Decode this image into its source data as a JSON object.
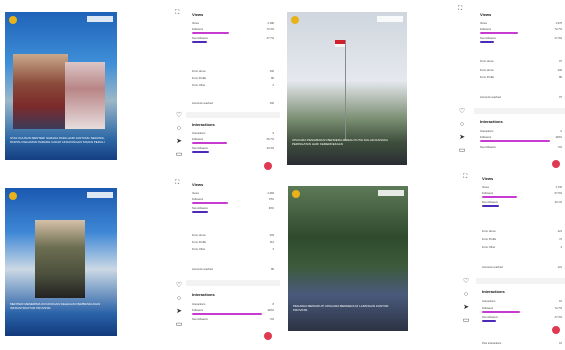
{
  "colors": {
    "followers": "#c63bd0",
    "non_followers": "#4d2bb8",
    "badge": "#e03a52"
  },
  "posts": [
    {
      "brand": "BerAKHLAK",
      "caption": "STAF KHUSUS MENTERI SARANA PADA HARI JANTUNG SEDUNIA, PANTAU KEGIATAN PARADE CAKAP LINGKUNGAN TAMAN PEDULI",
      "style": "blue"
    },
    {
      "brand": "BerAKHLAK",
      "caption": "UPACARA PENGIBARAN BENDERA MERAH PUTIH DALAM RANGKA PERINGATAN HARI KEMERDEKAAN",
      "style": "photo"
    },
    {
      "brand": "BerAKHLAK",
      "caption": "MENTERI MENERIMA KUNJUNGAN DELEGASI PEMBANGUNAN INFRASTRUKTUR PROVINSI",
      "style": "blue"
    },
    {
      "brand": "BerAKHLAK",
      "caption": "PEGAWAI MENGIKUTI UPACARA BENDERA DI LAPANGAN KANTOR PROVINSI",
      "style": "photo"
    }
  ],
  "insights": [
    {
      "views_title": "Views",
      "views_total": "2,180",
      "followers_label": "Followers",
      "followers_pct": "72.3%",
      "followers_frac": 0.72,
      "nonfollowers_label": "Non-followers",
      "nonfollowers_pct": "27.7%",
      "nonfollowers_frac": 0.28,
      "sources": [
        {
          "label": "From Home",
          "value": "192"
        },
        {
          "label": "From Profile",
          "value": "86"
        },
        {
          "label": "From Other",
          "value": "2"
        }
      ],
      "reached_label": "Accounts reached",
      "reached_value": "192",
      "interactions_title": "Interactions",
      "interactions_total": "9",
      "i_followers_pct": "66.7%",
      "i_followers_frac": 0.67,
      "i_nonfollowers_pct": "33.3%",
      "i_nonfollowers_frac": 0.33
    },
    {
      "views_title": "Views",
      "views_total": "1,976",
      "followers_label": "Followers",
      "followers_pct": "72.7%",
      "followers_frac": 0.73,
      "nonfollowers_label": "Non-followers",
      "nonfollowers_pct": "27.3%",
      "nonfollowers_frac": 0.27,
      "sources": [
        {
          "label": "From Home",
          "value": "97"
        },
        {
          "label": "From Home",
          "value": "232"
        },
        {
          "label": "From Profile",
          "value": "86"
        }
      ],
      "reached_label": "Accounts reached",
      "reached_value": "97",
      "interactions_title": "Interactions",
      "interactions_total": "6",
      "i_followers_pct": "100%",
      "i_followers_frac": 1.0,
      "i_nonfollowers_pct": "0%",
      "i_nonfollowers_frac": 0.0
    },
    {
      "views_title": "Views",
      "views_total": "2,284",
      "followers_label": "Followers",
      "followers_pct": "70%",
      "followers_frac": 0.7,
      "nonfollowers_label": "Non-followers",
      "nonfollowers_pct": "30%",
      "nonfollowers_frac": 0.3,
      "sources": [
        {
          "label": "From Home",
          "value": "203"
        },
        {
          "label": "From Profile",
          "value": "112"
        },
        {
          "label": "From Other",
          "value": "3"
        }
      ],
      "reached_label": "Accounts reached",
      "reached_value": "86",
      "interactions_title": "Interactions",
      "interactions_total": "8",
      "i_followers_pct": "100%",
      "i_followers_frac": 1.0,
      "i_nonfollowers_pct": "0%",
      "i_nonfollowers_frac": 0.0
    },
    {
      "views_title": "Views",
      "views_total": "1,732",
      "followers_label": "Followers",
      "followers_pct": "67.9%",
      "followers_frac": 0.68,
      "nonfollowers_label": "Non-followers",
      "nonfollowers_pct": "32.1%",
      "nonfollowers_frac": 0.32,
      "sources": [
        {
          "label": "From Home",
          "value": "121"
        },
        {
          "label": "From Profile",
          "value": "72"
        },
        {
          "label": "From Other",
          "value": "3"
        }
      ],
      "reached_label": "Accounts reached",
      "reached_value": "121",
      "interactions_title": "Interactions",
      "interactions_total": "16",
      "i_followers_pct": "72.7%",
      "i_followers_frac": 0.73,
      "i_nonfollowers_pct": "27.3%",
      "i_nonfollowers_frac": 0.27,
      "extra_label": "Post Interactions",
      "extra_value": "16"
    }
  ]
}
